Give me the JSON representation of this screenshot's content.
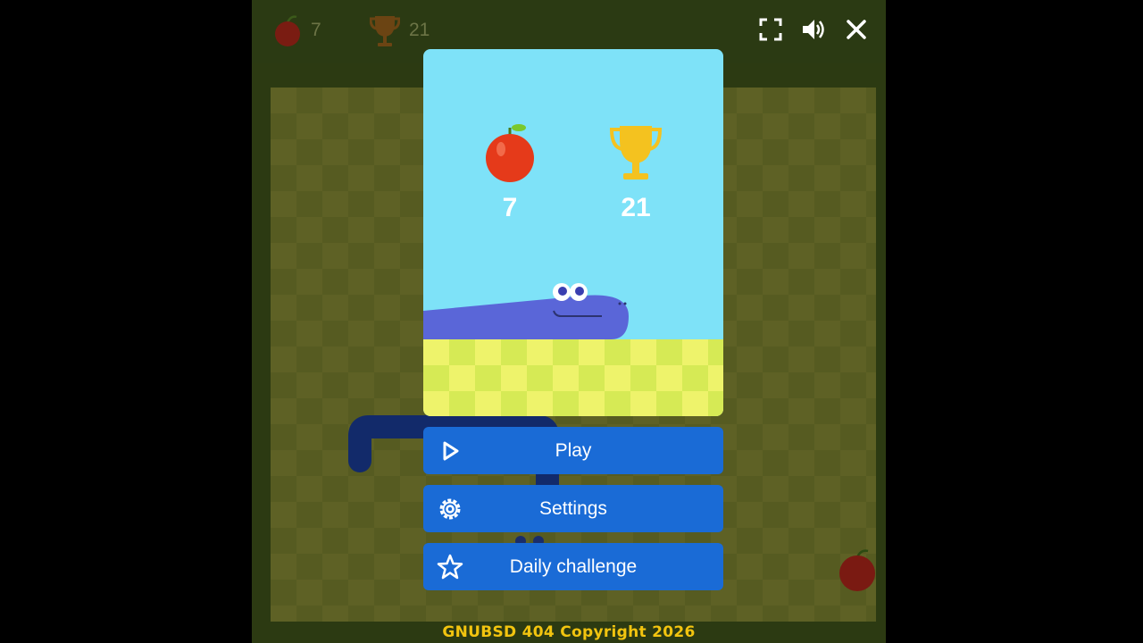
{
  "hud": {
    "apples": "7",
    "best": "21"
  },
  "controls": {
    "fullscreen_icon": "fullscreen-icon",
    "sound_icon": "speaker-icon",
    "close_icon": "close-icon"
  },
  "panel": {
    "score": "7",
    "high_score": "21"
  },
  "menu": {
    "play": "Play",
    "settings": "Settings",
    "daily": "Daily challenge"
  },
  "footer": "GNUBSD 404 Copyright 2026",
  "colors": {
    "button": "#1a6bd6",
    "sky": "#7ee2f8",
    "grass": "#eef36b",
    "snake": "#5a66d8",
    "footer": "#f2c40f"
  }
}
